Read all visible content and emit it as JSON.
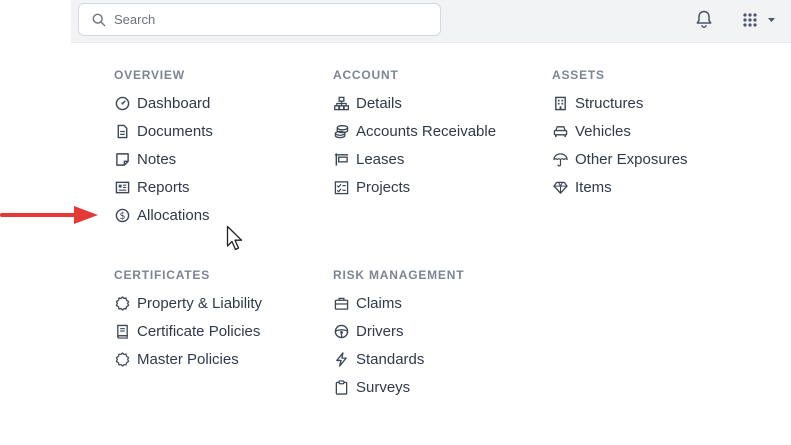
{
  "search": {
    "placeholder": "Search"
  },
  "colors": {
    "text": "#2f3a4a",
    "heading": "#7b8594",
    "arrow": "#e53935"
  },
  "sections": {
    "overview": {
      "heading": "OVERVIEW",
      "items": [
        {
          "label": "Dashboard",
          "icon": "gauge-icon"
        },
        {
          "label": "Documents",
          "icon": "document-icon"
        },
        {
          "label": "Notes",
          "icon": "note-icon"
        },
        {
          "label": "Reports",
          "icon": "newspaper-icon"
        },
        {
          "label": "Allocations",
          "icon": "dollar-circle-icon"
        }
      ]
    },
    "account": {
      "heading": "ACCOUNT",
      "items": [
        {
          "label": "Details",
          "icon": "sitemap-icon"
        },
        {
          "label": "Accounts Receivable",
          "icon": "coins-icon"
        },
        {
          "label": "Leases",
          "icon": "sign-icon"
        },
        {
          "label": "Projects",
          "icon": "tasks-icon"
        }
      ]
    },
    "assets": {
      "heading": "ASSETS",
      "items": [
        {
          "label": "Structures",
          "icon": "building-icon"
        },
        {
          "label": "Vehicles",
          "icon": "car-icon"
        },
        {
          "label": "Other Exposures",
          "icon": "umbrella-icon"
        },
        {
          "label": "Items",
          "icon": "gem-icon"
        }
      ]
    },
    "certificates": {
      "heading": "CERTIFICATES",
      "items": [
        {
          "label": "Property & Liability",
          "icon": "badge-icon"
        },
        {
          "label": "Certificate Policies",
          "icon": "book-icon"
        },
        {
          "label": "Master Policies",
          "icon": "badge-outline-icon"
        }
      ]
    },
    "risk": {
      "heading": "RISK MANAGEMENT",
      "items": [
        {
          "label": "Claims",
          "icon": "briefcase-icon"
        },
        {
          "label": "Drivers",
          "icon": "steering-wheel-icon"
        },
        {
          "label": "Standards",
          "icon": "bolt-icon"
        },
        {
          "label": "Surveys",
          "icon": "clipboard-icon"
        }
      ]
    }
  }
}
